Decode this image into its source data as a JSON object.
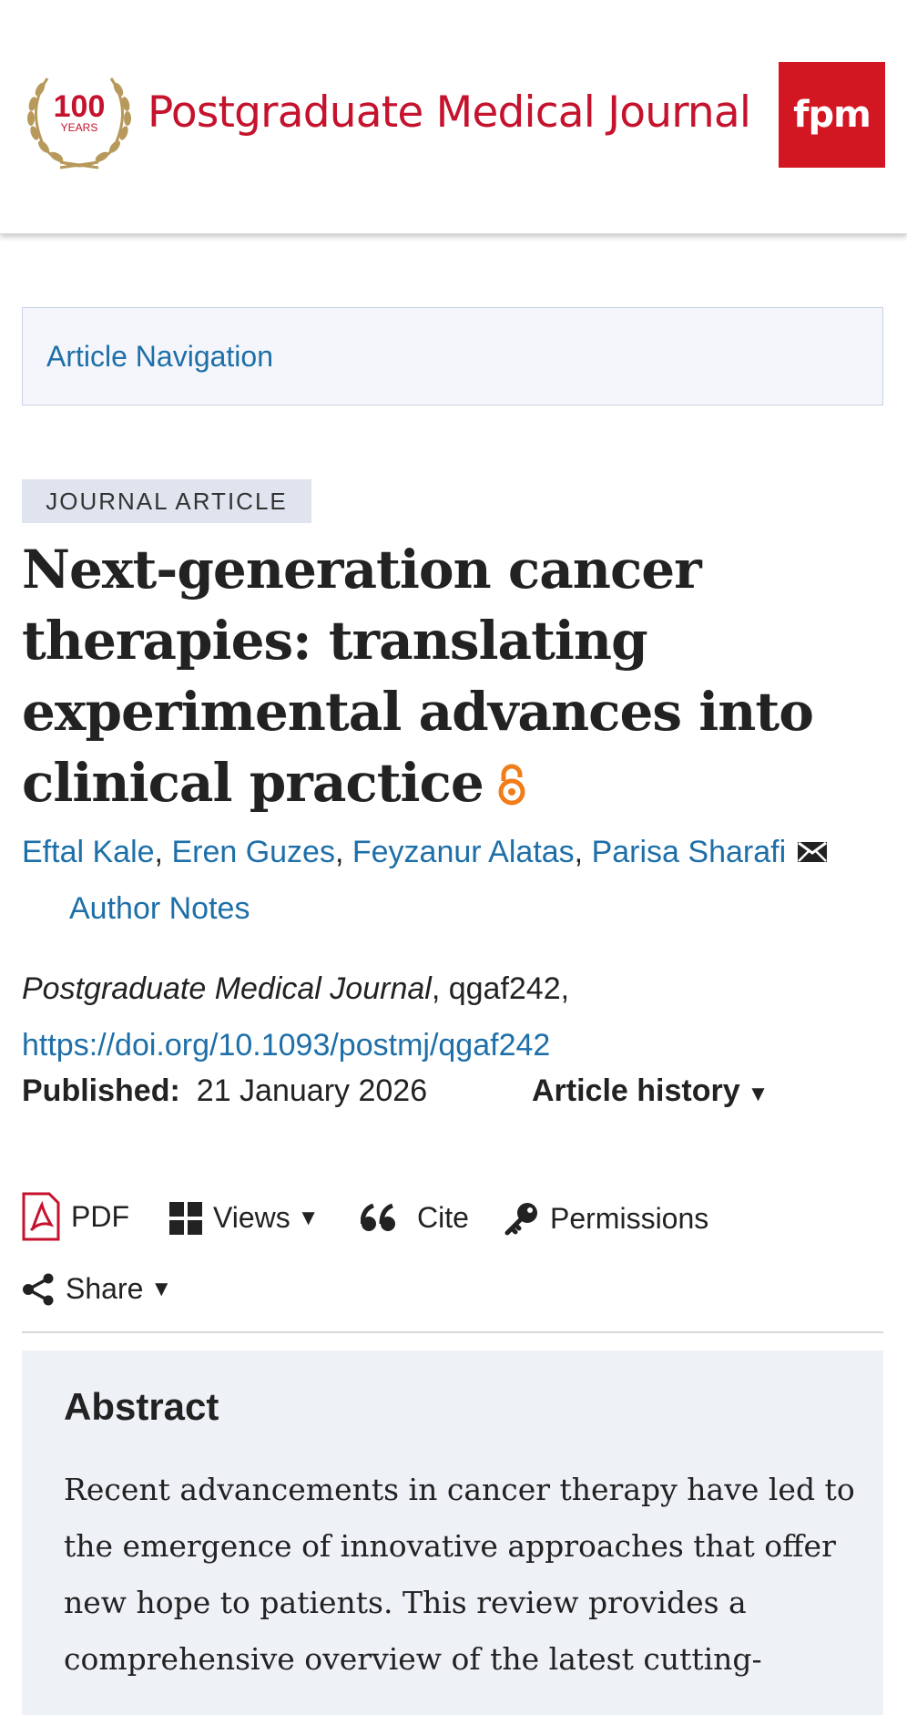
{
  "header": {
    "logo_badge_number": "100",
    "logo_badge_word": "YEARS",
    "journal_name": "Postgraduate Medical Journal",
    "fpm_badge": "fpm",
    "brand_color": "#c5122d",
    "badge_color": "#d21622"
  },
  "article_navigation": {
    "label": "Article Navigation"
  },
  "article": {
    "type": "JOURNAL ARTICLE",
    "title": "Next-generation cancer therapies: translating experimental advances into clinical practice",
    "open_access_icon": "open-access-icon",
    "authors": [
      "Eftal Kale",
      "Eren Guzes",
      "Feyzanur Alatas",
      "Parisa Sharafi"
    ],
    "author_separator": ", ",
    "author_notes_label": "Author Notes",
    "journal": "Postgraduate Medical Journal",
    "article_id": ", qgaf242,",
    "doi": "https://doi.org/10.1093/postmj/qgaf242",
    "published_label": "Published:",
    "published_date": "21 January 2026",
    "article_history_label": "Article history",
    "link_color": "#1e6fa8"
  },
  "toolbar": {
    "pdf": "PDF",
    "views": "Views",
    "cite": "Cite",
    "permissions": "Permissions",
    "share": "Share",
    "caret": "▼"
  },
  "abstract": {
    "heading": "Abstract",
    "text": "Recent advancements in cancer therapy have led to the emergence of innovative approaches that offer new hope to patients. This review provides a comprehensive overview of the latest cutting-"
  }
}
